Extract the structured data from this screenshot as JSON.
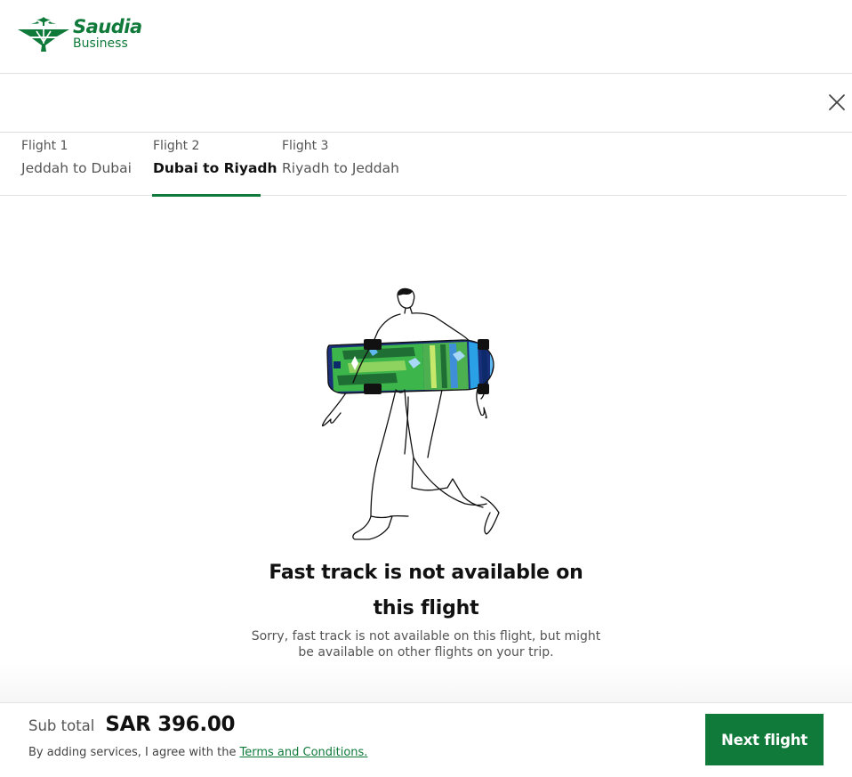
{
  "brand": {
    "name": "Saudia",
    "sub": "Business",
    "color": "#0f7a3a"
  },
  "close": {
    "icon": "close-icon"
  },
  "tabs": [
    {
      "num": "Flight 1",
      "route": "Jeddah to Dubai",
      "active": false
    },
    {
      "num": "Flight 2",
      "route": "Dubai to Riyadh",
      "active": true
    },
    {
      "num": "Flight 3",
      "route": "Riyadh to Jeddah",
      "active": false
    }
  ],
  "empty": {
    "illustration": "person-carrying-skateboard-illustration",
    "title": "Fast track is not available on this flight",
    "text": "Sorry, fast track is not available on this flight, but might be available on other flights on your trip."
  },
  "footer": {
    "subtotal_label": "Sub total",
    "subtotal_amount": "SAR 396.00",
    "agree_text": "By adding services, I agree with the",
    "terms_link": "Terms and Conditions.",
    "next_button": "Next flight"
  }
}
